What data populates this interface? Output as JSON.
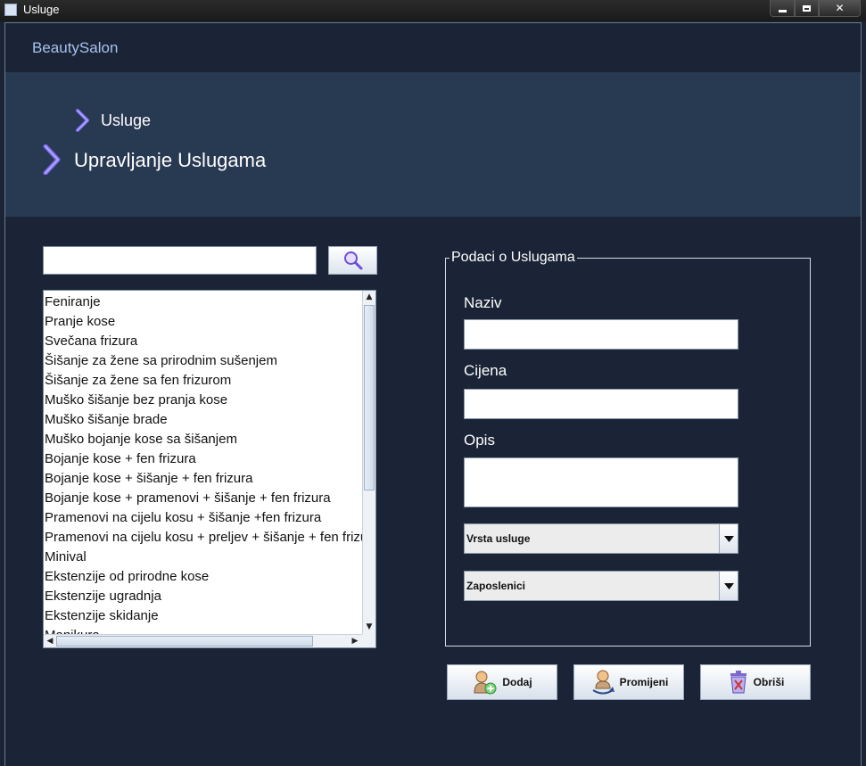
{
  "window": {
    "title": "Usluge",
    "min_glyph": "",
    "close_glyph": "✕"
  },
  "app": {
    "brand": "BeautySalon"
  },
  "breadcrumb": {
    "parent": "Usluge",
    "current": "Upravljanje Uslugama"
  },
  "search": {
    "value": "",
    "placeholder": ""
  },
  "services": {
    "items": [
      "Feniranje",
      "Pranje kose",
      "Svečana frizura",
      "Šišanje za žene sa prirodnim sušenjem",
      "Šišanje za žene sa fen frizurom",
      "Muško šišanje bez pranja kose",
      "Muško šišanje brade",
      "Muško bojanje kose sa šišanjem",
      "Bojanje kose + fen frizura",
      "Bojanje kose + šišanje + fen frizura",
      "Bojanje kose + pramenovi + šišanje + fen frizura",
      "Pramenovi na cijelu kosu + šišanje +fen frizura",
      "Pramenovi na  cijelu kosu + preljev + šišanje + fen frizura",
      "Minival",
      "Ekstenzije od prirodne kose",
      "Ekstenzije ugradnja",
      "Ekstenzije skidanje",
      "Manikura"
    ]
  },
  "form": {
    "legend": "Podaci o Uslugama",
    "naziv_label": "Naziv",
    "naziv_value": "",
    "cijena_label": "Cijena",
    "cijena_value": "",
    "opis_label": "Opis",
    "opis_value": "",
    "vrsta_selected": "Vrsta usluge",
    "zaposlenici_selected": "Zaposlenici"
  },
  "actions": {
    "add_label": "Dodaj",
    "change_label": "Promijeni",
    "delete_label": "Obriši"
  },
  "colors": {
    "background": "#1a2436",
    "hero": "#283952",
    "brand": "#a9c1ec",
    "chevron": "#7b6cf0"
  }
}
